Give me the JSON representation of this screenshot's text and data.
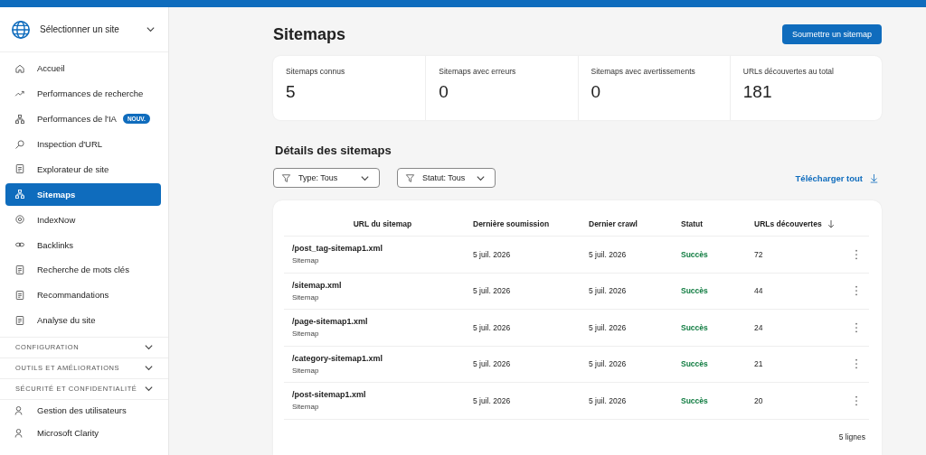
{
  "site_selector": {
    "label": "Sélectionner un site"
  },
  "sidebar": {
    "items": [
      {
        "label": "Accueil",
        "selected": false
      },
      {
        "label": "Performances de recherche",
        "selected": false
      },
      {
        "label": "Performances de l'IA",
        "selected": false,
        "badge": "NOUV."
      },
      {
        "label": "Inspection d'URL",
        "selected": false
      },
      {
        "label": "Explorateur de site",
        "selected": false
      },
      {
        "label": "Sitemaps",
        "selected": true
      },
      {
        "label": "IndexNow",
        "selected": false
      },
      {
        "label": "Backlinks",
        "selected": false
      },
      {
        "label": "Recherche de mots clés",
        "selected": false
      },
      {
        "label": "Recommandations",
        "selected": false
      },
      {
        "label": "Analyse du site",
        "selected": false
      }
    ],
    "sections": [
      {
        "label": "CONFIGURATION",
        "expanded": false
      },
      {
        "label": "OUTILS ET AMÉLIORATIONS",
        "expanded": false
      },
      {
        "label": "SÉCURITÉ ET CONFIDENTIALITÉ",
        "expanded": false
      }
    ],
    "bottom_items": [
      {
        "label": "Gestion des utilisateurs"
      },
      {
        "label": "Microsoft Clarity"
      }
    ]
  },
  "page": {
    "title": "Sitemaps",
    "submit_button": "Soumettre un sitemap"
  },
  "stats": [
    {
      "label": "Sitemaps connus",
      "value": "5"
    },
    {
      "label": "Sitemaps avec erreurs",
      "value": "0"
    },
    {
      "label": "Sitemaps avec avertissements",
      "value": "0"
    },
    {
      "label": "URLs découvertes au total",
      "value": "181"
    }
  ],
  "details": {
    "title": "Détails des sitemaps",
    "filters": [
      "Type: Tous",
      "Statut: Tous"
    ],
    "download": "Télécharger tout"
  },
  "table": {
    "columns": [
      "URL du sitemap",
      "Dernière soumission",
      "Dernier crawl",
      "Statut",
      "URLs découvertes"
    ],
    "rows": [
      {
        "url": "/post_tag-sitemap1.xml",
        "type": "Sitemap",
        "submitted": "5 juil. 2026",
        "crawled": "5 juil. 2026",
        "status": "Succès",
        "urls": "72"
      },
      {
        "url": "/sitemap.xml",
        "type": "Sitemap",
        "submitted": "5 juil. 2026",
        "crawled": "5 juil. 2026",
        "status": "Succès",
        "urls": "44"
      },
      {
        "url": "/page-sitemap1.xml",
        "type": "Sitemap",
        "submitted": "5 juil. 2026",
        "crawled": "5 juil. 2026",
        "status": "Succès",
        "urls": "24"
      },
      {
        "url": "/category-sitemap1.xml",
        "type": "Sitemap",
        "submitted": "5 juil. 2026",
        "crawled": "5 juil. 2026",
        "status": "Succès",
        "urls": "21"
      },
      {
        "url": "/post-sitemap1.xml",
        "type": "Sitemap",
        "submitted": "5 juil. 2026",
        "crawled": "5 juil. 2026",
        "status": "Succès",
        "urls": "20"
      }
    ],
    "footer": "5 lignes"
  }
}
